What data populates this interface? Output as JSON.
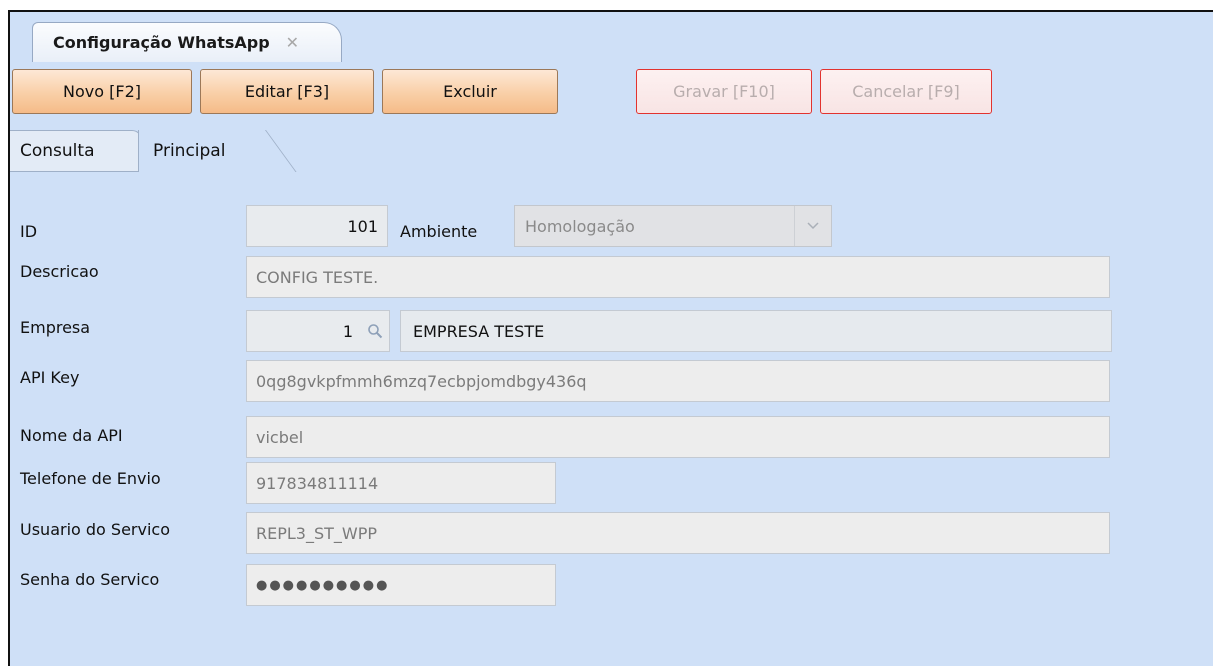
{
  "document_tab": {
    "title": "Configuração WhatsApp",
    "close_glyph": "✕"
  },
  "toolbar": {
    "novo": "Novo [F2]",
    "editar": "Editar [F3]",
    "excluir": "Excluir",
    "gravar": "Gravar [F10]",
    "cancelar": "Cancelar [F9]"
  },
  "subtabs": {
    "consulta": "Consulta",
    "principal": "Principal"
  },
  "form": {
    "id": {
      "label": "ID",
      "value": "101"
    },
    "ambiente": {
      "label": "Ambiente",
      "value": "Homologação"
    },
    "descricao": {
      "label": "Descricao",
      "value": "CONFIG TESTE."
    },
    "empresa": {
      "label": "Empresa",
      "code": "1",
      "name": "EMPRESA TESTE"
    },
    "api_key": {
      "label": "API Key",
      "value": "0qg8gvkpfmmh6mzq7ecbpjomdbgy436q"
    },
    "nome_api": {
      "label": "Nome da API",
      "value": "vicbel"
    },
    "telefone": {
      "label": "Telefone de Envio",
      "value": "917834811114"
    },
    "usuario": {
      "label": "Usuario do Servico",
      "value": "REPL3_ST_WPP"
    },
    "senha": {
      "label": "Senha do Servico",
      "value": "●●●●●●●●●●"
    }
  },
  "icons": {
    "close": "close-icon",
    "dropdown": "chevron-down-icon",
    "search": "search-icon"
  },
  "colors": {
    "background": "#cfe0f7",
    "action_button": "#f9cfa7",
    "disabled_border": "#e2332f"
  }
}
